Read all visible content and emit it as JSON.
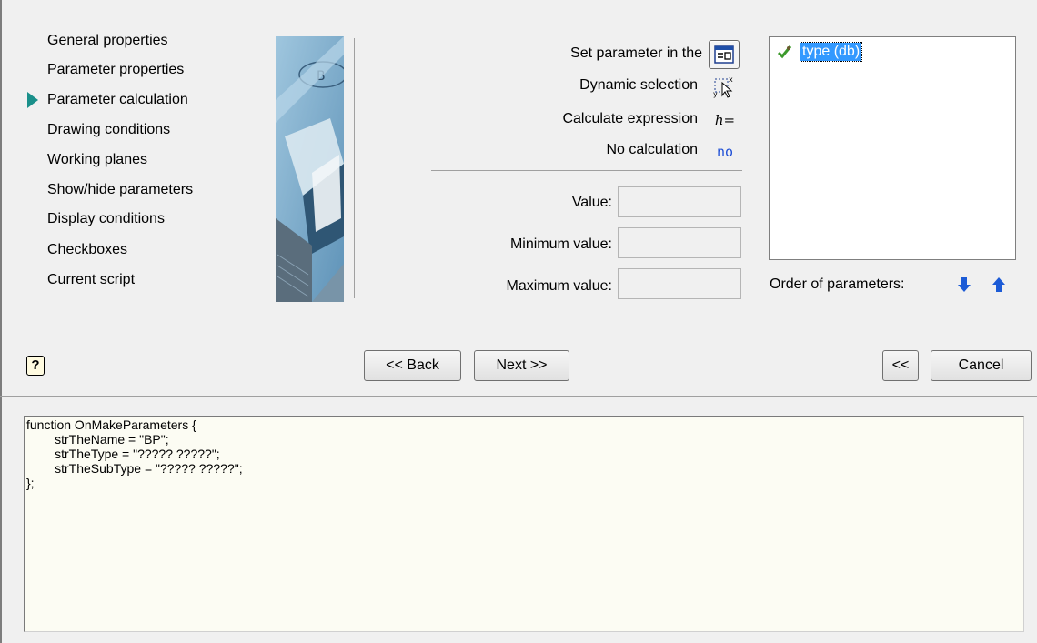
{
  "nav": {
    "items": [
      {
        "label": "General properties"
      },
      {
        "label": "Parameter properties"
      },
      {
        "label": "Parameter calculation",
        "active": true
      },
      {
        "label": "Drawing conditions"
      },
      {
        "label": "Working planes"
      },
      {
        "label": "Show/hide parameters"
      },
      {
        "label": "Display conditions"
      },
      {
        "label": "Checkboxes"
      },
      {
        "label": "Current script"
      }
    ]
  },
  "calc": {
    "set_parameter_label": "Set parameter in the",
    "dynamic_selection_label": "Dynamic selection",
    "calculate_expression_label": "Calculate expression",
    "calculate_expression_icon": "h=",
    "no_calculation_label": "No calculation",
    "no_calculation_icon": "no"
  },
  "values": {
    "value_label": "Value:",
    "value": "",
    "min_label": "Minimum value:",
    "min": "",
    "max_label": "Maximum value:",
    "max": ""
  },
  "parameters": {
    "items": [
      "type  (db)"
    ],
    "order_label": "Order of parameters:"
  },
  "buttons": {
    "help": "?",
    "back": "<< Back",
    "next": "Next >>",
    "collapse": "<<",
    "cancel": "Cancel"
  },
  "script": {
    "text": "function OnMakeParameters {\n\t\tstrTheName = \"BP\";\n\t\tstrTheType = \"????? ?????\";\n\t\tstrTheSubType = \"????? ?????\";\n};"
  },
  "colors": {
    "accent_arrow": "#1a8f8a",
    "selection": "#3399ff",
    "order_arrows": "#1c5bd6",
    "script_bg": "#fcfcf3"
  }
}
